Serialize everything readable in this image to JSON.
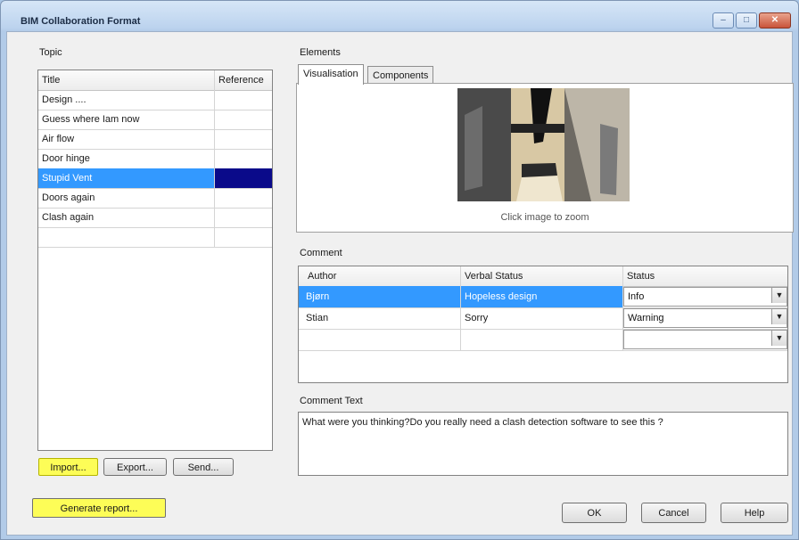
{
  "window": {
    "title": "BIM Collaboration Format",
    "min_icon": "minimize-icon",
    "max_icon": "maximize-icon",
    "close_icon": "close-icon"
  },
  "topic": {
    "group_label": "Topic",
    "columns": [
      "Title",
      "Reference"
    ],
    "rows": [
      {
        "title": "Design ....",
        "reference": ""
      },
      {
        "title": "Guess where Iam now",
        "reference": ""
      },
      {
        "title": "Air flow",
        "reference": ""
      },
      {
        "title": "Door hinge",
        "reference": ""
      },
      {
        "title": "Stupid Vent",
        "reference": ""
      },
      {
        "title": "Doors again",
        "reference": ""
      },
      {
        "title": "Clash  again",
        "reference": ""
      },
      {
        "title": "",
        "reference": ""
      }
    ],
    "selected_index": 4,
    "buttons": {
      "import": "Import...",
      "export": "Export...",
      "send": "Send..."
    }
  },
  "generate_report": "Generate report...",
  "elements": {
    "group_label": "Elements",
    "tabs": [
      "Visualisation",
      "Components"
    ],
    "active_tab": 0,
    "image_caption": "Click image to zoom"
  },
  "comment": {
    "group_label": "Comment",
    "columns": [
      "Author",
      "Verbal Status",
      "Status"
    ],
    "rows": [
      {
        "author": "Bjørn",
        "verbal": "Hopeless design",
        "status": "Info"
      },
      {
        "author": "Stian",
        "verbal": "Sorry",
        "status": "Warning"
      },
      {
        "author": "",
        "verbal": "",
        "status": ""
      }
    ],
    "selected_index": 0
  },
  "comment_text": {
    "label": "Comment Text",
    "value": "What were you thinking?Do you really need a clash detection software to see this ?"
  },
  "footer": {
    "ok": "OK",
    "cancel": "Cancel",
    "help": "Help"
  },
  "colors": {
    "selection": "#3399ff",
    "highlight": "#ffff3c",
    "titlebar": "#bcd3ee"
  }
}
